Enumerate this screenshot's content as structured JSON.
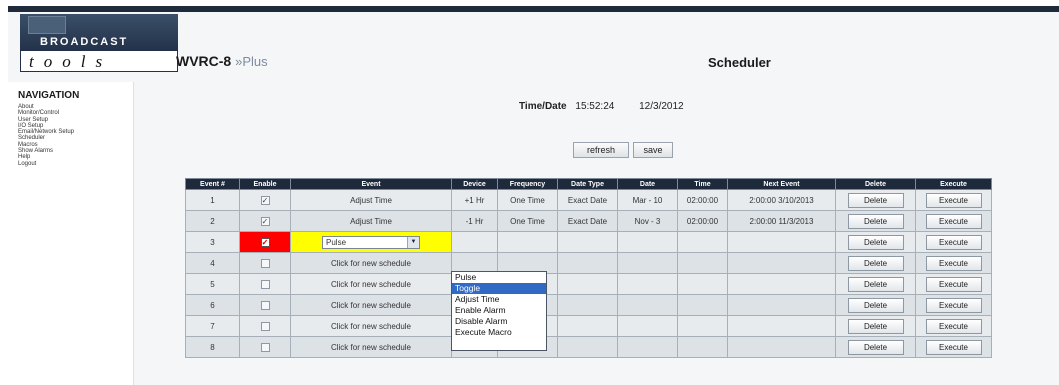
{
  "header": {
    "logo_top": "BROADCAST",
    "logo_bottom": "tools",
    "model": "WVRC-8",
    "model_suffix": "»Plus",
    "page_title": "Scheduler"
  },
  "navigation": {
    "title": "NAVIGATION",
    "items": [
      "About",
      "Monitor/Control",
      "User Setup",
      "I/O Setup",
      "Email/Network Setup",
      "Scheduler",
      "Macros",
      "Show Alarms",
      "Help",
      "Logout"
    ]
  },
  "status": {
    "label": "Time/Date",
    "time": "15:52:24",
    "date": "12/3/2012"
  },
  "buttons": {
    "refresh": "refresh",
    "save": "save"
  },
  "table": {
    "headers": [
      "Event #",
      "Enable",
      "Event",
      "Device",
      "Frequency",
      "Date Type",
      "Date",
      "Time",
      "Next Event",
      "Delete",
      "Execute"
    ],
    "rows": [
      {
        "num": "1",
        "enabled": "✓",
        "event": "Adjust Time",
        "device": "+1 Hr",
        "frequency": "One Time",
        "date_type": "Exact Date",
        "date": "Mar - 10",
        "time": "02:00:00",
        "next": "2:00:00 3/10/2013",
        "delete": "Delete",
        "execute": "Execute"
      },
      {
        "num": "2",
        "enabled": "✓",
        "event": "Adjust Time",
        "device": "-1 Hr",
        "frequency": "One Time",
        "date_type": "Exact Date",
        "date": "Nov - 3",
        "time": "02:00:00",
        "next": "2:00:00 11/3/2013",
        "delete": "Delete",
        "execute": "Execute"
      },
      {
        "num": "3",
        "enabled": "✓",
        "event": "Pulse",
        "device": "",
        "frequency": "",
        "date_type": "",
        "date": "",
        "time": "",
        "next": "",
        "delete": "Delete",
        "execute": "Execute"
      },
      {
        "num": "4",
        "enabled": "",
        "event": "Click for new schedule",
        "device": "",
        "frequency": "",
        "date_type": "",
        "date": "",
        "time": "",
        "next": "",
        "delete": "Delete",
        "execute": "Execute"
      },
      {
        "num": "5",
        "enabled": "",
        "event": "Click for new schedule",
        "device": "",
        "frequency": "",
        "date_type": "",
        "date": "",
        "time": "",
        "next": "",
        "delete": "Delete",
        "execute": "Execute"
      },
      {
        "num": "6",
        "enabled": "",
        "event": "Click for new schedule",
        "device": "",
        "frequency": "",
        "date_type": "",
        "date": "",
        "time": "",
        "next": "",
        "delete": "Delete",
        "execute": "Execute"
      },
      {
        "num": "7",
        "enabled": "",
        "event": "Click for new schedule",
        "device": "",
        "frequency": "",
        "date_type": "",
        "date": "",
        "time": "",
        "next": "",
        "delete": "Delete",
        "execute": "Execute"
      },
      {
        "num": "8",
        "enabled": "",
        "event": "Click for new schedule",
        "device": "",
        "frequency": "",
        "date_type": "",
        "date": "",
        "time": "",
        "next": "",
        "delete": "Delete",
        "execute": "Execute"
      }
    ]
  },
  "dropdown": {
    "selected": "Toggle",
    "options": [
      "Pulse",
      "Toggle",
      "Adjust Time",
      "Enable Alarm",
      "Disable Alarm",
      "Execute Macro"
    ]
  },
  "colors": {
    "header_bg": "#1e2a3c",
    "enable_highlight": "#ff0000",
    "event_highlight": "#ffff00",
    "dropdown_selected": "#316ac5"
  }
}
